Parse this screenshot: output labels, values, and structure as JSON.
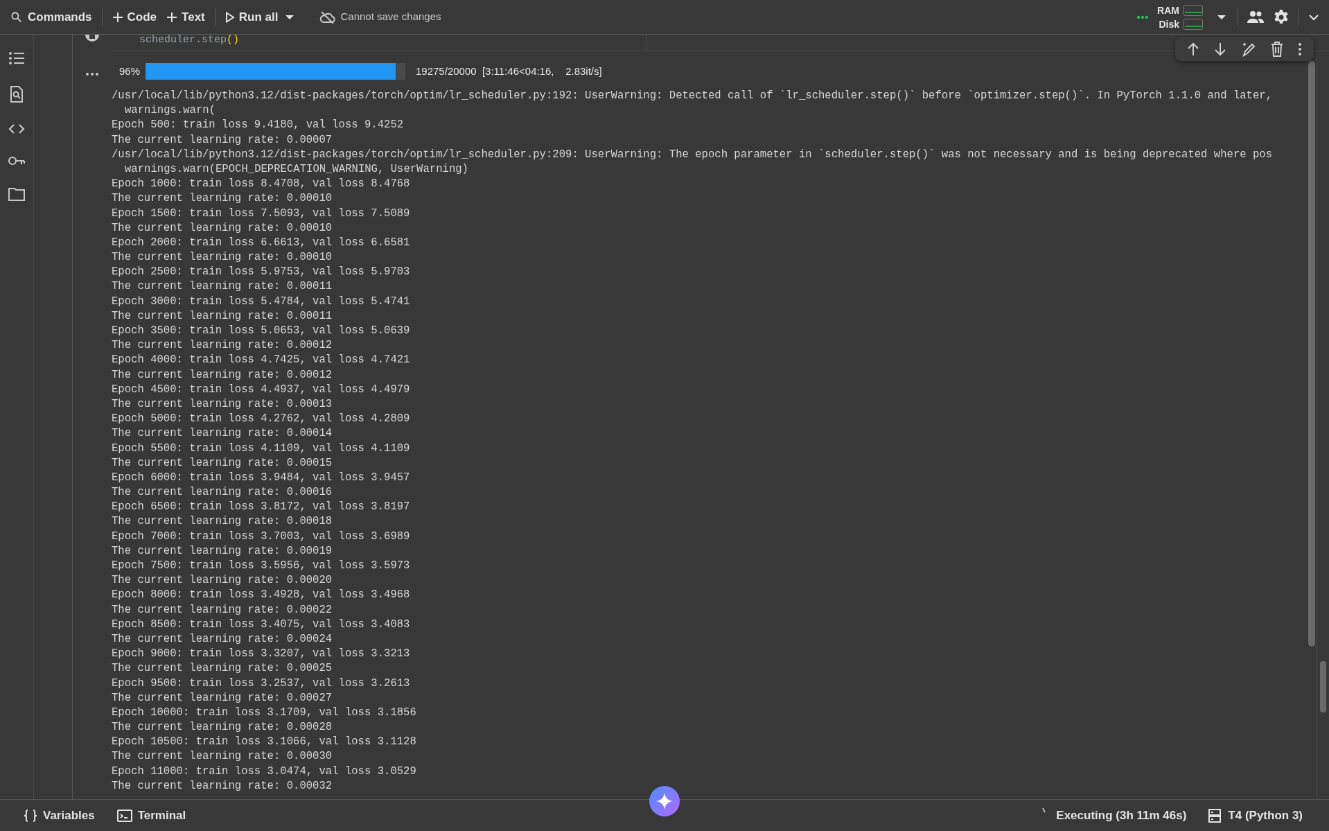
{
  "toolbar": {
    "commands": "Commands",
    "add_code": "Code",
    "add_text": "Text",
    "run_all": "Run all",
    "save_status": "Cannot save changes",
    "ram_label": "RAM",
    "disk_label": "Disk"
  },
  "cell": {
    "code": [
      {
        "kind": "plain",
        "text": "scheduler.step"
      },
      {
        "kind": "bracket",
        "text": "()"
      }
    ],
    "progress": {
      "percent": "96%",
      "level": 0.963,
      "stats": "19275/20000  [3:11:46<04:16,    2.83it/s]"
    },
    "output_lines": [
      {
        "kind": "text",
        "text": "/usr/local/lib/python3.12/dist-packages/torch/optim/lr_scheduler.py:192: UserWarning: Detected call of `lr_scheduler.step()` before `optimizer.step()`. In PyTorch 1.1.0 and later,"
      },
      {
        "kind": "indent",
        "text": "warnings.warn("
      },
      {
        "kind": "text",
        "text": "Epoch 500: train loss 9.4180, val loss 9.4252"
      },
      {
        "kind": "text",
        "text": "The current learning rate: 0.00007"
      },
      {
        "kind": "text",
        "text": "/usr/local/lib/python3.12/dist-packages/torch/optim/lr_scheduler.py:209: UserWarning: The epoch parameter in `scheduler.step()` was not necessary and is being deprecated where pos"
      },
      {
        "kind": "indent",
        "text": "warnings.warn(EPOCH_DEPRECATION_WARNING, UserWarning)"
      },
      {
        "kind": "text",
        "text": "Epoch 1000: train loss 8.4708, val loss 8.4768"
      },
      {
        "kind": "text",
        "text": "The current learning rate: 0.00010"
      },
      {
        "kind": "text",
        "text": "Epoch 1500: train loss 7.5093, val loss 7.5089"
      },
      {
        "kind": "text",
        "text": "The current learning rate: 0.00010"
      },
      {
        "kind": "text",
        "text": "Epoch 2000: train loss 6.6613, val loss 6.6581"
      },
      {
        "kind": "text",
        "text": "The current learning rate: 0.00010"
      },
      {
        "kind": "text",
        "text": "Epoch 2500: train loss 5.9753, val loss 5.9703"
      },
      {
        "kind": "text",
        "text": "The current learning rate: 0.00011"
      },
      {
        "kind": "text",
        "text": "Epoch 3000: train loss 5.4784, val loss 5.4741"
      },
      {
        "kind": "text",
        "text": "The current learning rate: 0.00011"
      },
      {
        "kind": "text",
        "text": "Epoch 3500: train loss 5.0653, val loss 5.0639"
      },
      {
        "kind": "text",
        "text": "The current learning rate: 0.00012"
      },
      {
        "kind": "text",
        "text": "Epoch 4000: train loss 4.7425, val loss 4.7421"
      },
      {
        "kind": "text",
        "text": "The current learning rate: 0.00012"
      },
      {
        "kind": "text",
        "text": "Epoch 4500: train loss 4.4937, val loss 4.4979"
      },
      {
        "kind": "text",
        "text": "The current learning rate: 0.00013"
      },
      {
        "kind": "text",
        "text": "Epoch 5000: train loss 4.2762, val loss 4.2809"
      },
      {
        "kind": "text",
        "text": "The current learning rate: 0.00014"
      },
      {
        "kind": "text",
        "text": "Epoch 5500: train loss 4.1109, val loss 4.1109"
      },
      {
        "kind": "text",
        "text": "The current learning rate: 0.00015"
      },
      {
        "kind": "text",
        "text": "Epoch 6000: train loss 3.9484, val loss 3.9457"
      },
      {
        "kind": "text",
        "text": "The current learning rate: 0.00016"
      },
      {
        "kind": "text",
        "text": "Epoch 6500: train loss 3.8172, val loss 3.8197"
      },
      {
        "kind": "text",
        "text": "The current learning rate: 0.00018"
      },
      {
        "kind": "text",
        "text": "Epoch 7000: train loss 3.7003, val loss 3.6989"
      },
      {
        "kind": "text",
        "text": "The current learning rate: 0.00019"
      },
      {
        "kind": "text",
        "text": "Epoch 7500: train loss 3.5956, val loss 3.5973"
      },
      {
        "kind": "text",
        "text": "The current learning rate: 0.00020"
      },
      {
        "kind": "text",
        "text": "Epoch 8000: train loss 3.4928, val loss 3.4968"
      },
      {
        "kind": "text",
        "text": "The current learning rate: 0.00022"
      },
      {
        "kind": "text",
        "text": "Epoch 8500: train loss 3.4075, val loss 3.4083"
      },
      {
        "kind": "text",
        "text": "The current learning rate: 0.00024"
      },
      {
        "kind": "text",
        "text": "Epoch 9000: train loss 3.3207, val loss 3.3213"
      },
      {
        "kind": "text",
        "text": "The current learning rate: 0.00025"
      },
      {
        "kind": "text",
        "text": "Epoch 9500: train loss 3.2537, val loss 3.2613"
      },
      {
        "kind": "text",
        "text": "The current learning rate: 0.00027"
      },
      {
        "kind": "text",
        "text": "Epoch 10000: train loss 3.1709, val loss 3.1856"
      },
      {
        "kind": "text",
        "text": "The current learning rate: 0.00028"
      },
      {
        "kind": "text",
        "text": "Epoch 10500: train loss 3.1066, val loss 3.1128"
      },
      {
        "kind": "text",
        "text": "The current learning rate: 0.00030"
      },
      {
        "kind": "text",
        "text": "Epoch 11000: train loss 3.0474, val loss 3.0529"
      },
      {
        "kind": "text",
        "text": "The current learning rate: 0.00032"
      }
    ]
  },
  "status_bar": {
    "variables": "Variables",
    "terminal": "Terminal",
    "executing": "Executing (3h 11m 46s)",
    "runtime": "T4 (Python 3)"
  }
}
